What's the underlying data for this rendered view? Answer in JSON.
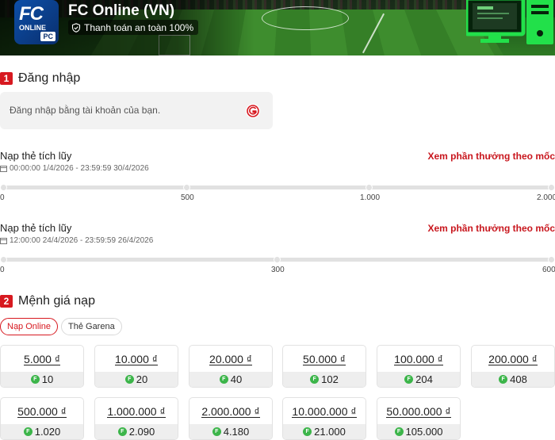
{
  "header": {
    "game_title": "FC Online (VN)",
    "secure_badge": "Thanh toán an toàn 100%",
    "logo": {
      "line1": "FC",
      "line2": "ONLINE",
      "badge": "PC"
    }
  },
  "login": {
    "step": "1",
    "title": "Đăng nhập",
    "prompt": "Đăng nhập bằng tài khoản của bạn.",
    "icon": "garena-icon"
  },
  "cumulative": [
    {
      "title": "Nạp thẻ tích lũy",
      "date_range": "00:00:00 1/4/2026 - 23:59:59 30/4/2026",
      "link": "Xem phần thưởng theo mốc",
      "ticks": [
        "0",
        "500",
        "1.000",
        "2.000"
      ],
      "progress": 0
    },
    {
      "title": "Nạp thẻ tích lũy",
      "date_range": "12:00:00 24/4/2026 - 23:59:59 26/4/2026",
      "link": "Xem phần thưởng theo mốc",
      "ticks": [
        "0",
        "300",
        "600"
      ],
      "progress": 0
    }
  ],
  "denominations": {
    "step": "2",
    "title": "Mệnh giá nạp",
    "tabs": [
      {
        "label": "Nạp Online",
        "active": true
      },
      {
        "label": "Thẻ Garena",
        "active": false
      }
    ],
    "cards": [
      {
        "price": "5.000 ₫",
        "points": "10"
      },
      {
        "price": "10.000 ₫",
        "points": "20"
      },
      {
        "price": "20.000 ₫",
        "points": "40"
      },
      {
        "price": "50.000 ₫",
        "points": "102"
      },
      {
        "price": "100.000 ₫",
        "points": "204"
      },
      {
        "price": "200.000 ₫",
        "points": "408"
      },
      {
        "price": "500.000 ₫",
        "points": "1.020"
      },
      {
        "price": "1.000.000 ₫",
        "points": "2.090"
      },
      {
        "price": "2.000.000 ₫",
        "points": "4.180"
      },
      {
        "price": "10.000.000 ₫",
        "points": "21.000"
      },
      {
        "price": "50.000.000 ₫",
        "points": "105.000"
      }
    ]
  },
  "colors": {
    "accent": "#d71920",
    "coin": "#3cb54a",
    "monitor": "#22e04a"
  }
}
